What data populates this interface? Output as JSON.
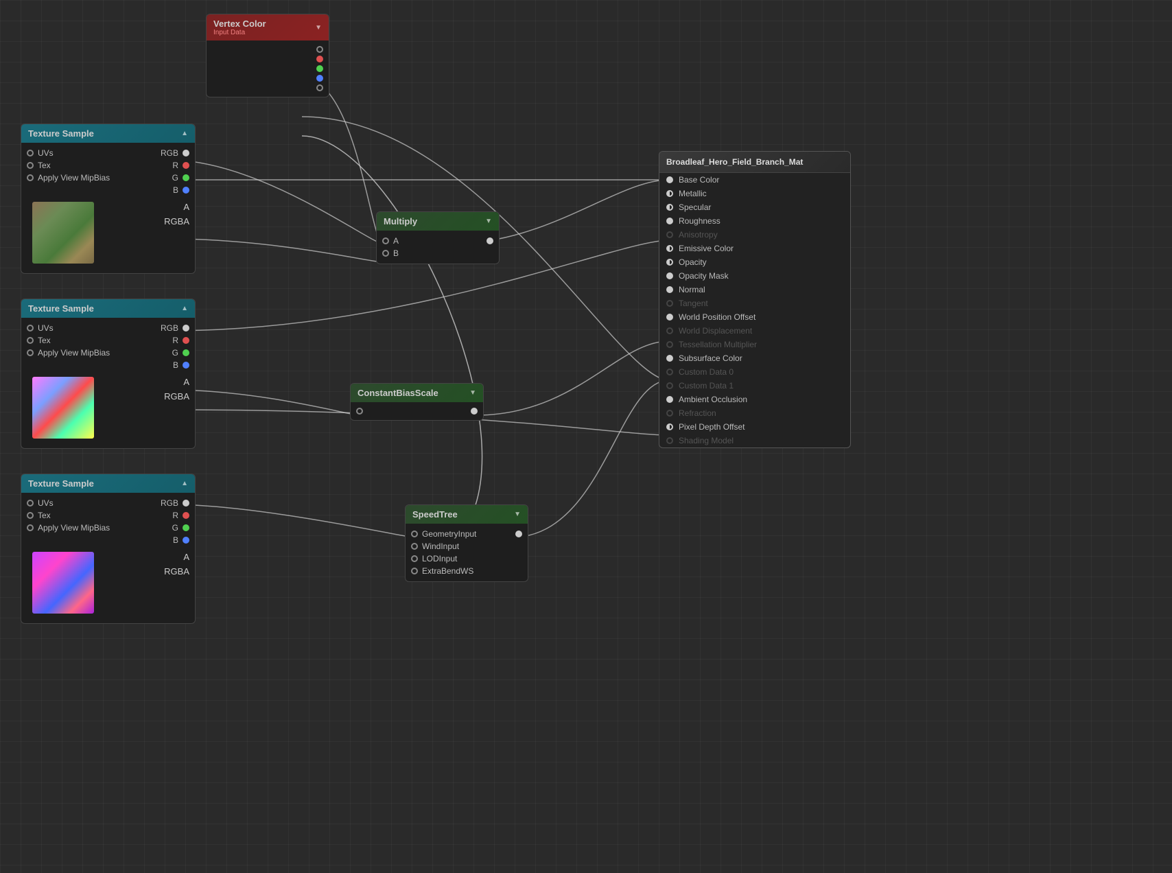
{
  "nodes": {
    "vertex_color": {
      "title": "Vertex Color",
      "subtitle": "Input Data",
      "pins_right": [
        "white_empty",
        "red",
        "green",
        "blue",
        "gray"
      ]
    },
    "texture_sample_1": {
      "title": "Texture Sample",
      "rows_left": [
        "UVs",
        "Tex",
        "Apply View MipBias"
      ],
      "rows_right": [
        "RGB",
        "R",
        "G",
        "B",
        "A",
        "RGBA"
      ],
      "thumb": "thumb-1"
    },
    "texture_sample_2": {
      "title": "Texture Sample",
      "rows_left": [
        "UVs",
        "Tex",
        "Apply View MipBias"
      ],
      "rows_right": [
        "RGB",
        "R",
        "G",
        "B",
        "A",
        "RGBA"
      ],
      "thumb": "thumb-2"
    },
    "texture_sample_3": {
      "title": "Texture Sample",
      "rows_left": [
        "UVs",
        "Tex",
        "Apply View MipBias"
      ],
      "rows_right": [
        "RGB",
        "R",
        "G",
        "B",
        "A",
        "RGBA"
      ],
      "thumb": "thumb-3"
    },
    "multiply": {
      "title": "Multiply",
      "pins_left": [
        "A",
        "B"
      ],
      "pins_right": [
        "out"
      ]
    },
    "constant_bias_scale": {
      "title": "ConstantBiasScale",
      "pins_left": [
        "in"
      ],
      "pins_right": [
        "out"
      ]
    },
    "speed_tree": {
      "title": "SpeedTree",
      "rows": [
        "GeometryInput",
        "WindInput",
        "LODInput",
        "ExtraBendWS"
      ],
      "pin_right": "GeometryInput"
    },
    "material": {
      "title": "Broadleaf_Hero_Field_Branch_Mat",
      "properties": [
        {
          "label": "Base Color",
          "type": "filled"
        },
        {
          "label": "Metallic",
          "type": "half"
        },
        {
          "label": "Specular",
          "type": "half"
        },
        {
          "label": "Roughness",
          "type": "filled"
        },
        {
          "label": "Anisotropy",
          "type": "disabled"
        },
        {
          "label": "Emissive Color",
          "type": "half"
        },
        {
          "label": "Opacity",
          "type": "half"
        },
        {
          "label": "Opacity Mask",
          "type": "filled"
        },
        {
          "label": "Normal",
          "type": "filled"
        },
        {
          "label": "Tangent",
          "type": "disabled"
        },
        {
          "label": "World Position Offset",
          "type": "filled"
        },
        {
          "label": "World Displacement",
          "type": "disabled"
        },
        {
          "label": "Tessellation Multiplier",
          "type": "disabled"
        },
        {
          "label": "Subsurface Color",
          "type": "filled"
        },
        {
          "label": "Custom Data 0",
          "type": "disabled"
        },
        {
          "label": "Custom Data 1",
          "type": "disabled"
        },
        {
          "label": "Ambient Occlusion",
          "type": "filled"
        },
        {
          "label": "Refraction",
          "type": "disabled"
        },
        {
          "label": "Pixel Depth Offset",
          "type": "half"
        },
        {
          "label": "Shading Model",
          "type": "disabled"
        }
      ]
    }
  }
}
